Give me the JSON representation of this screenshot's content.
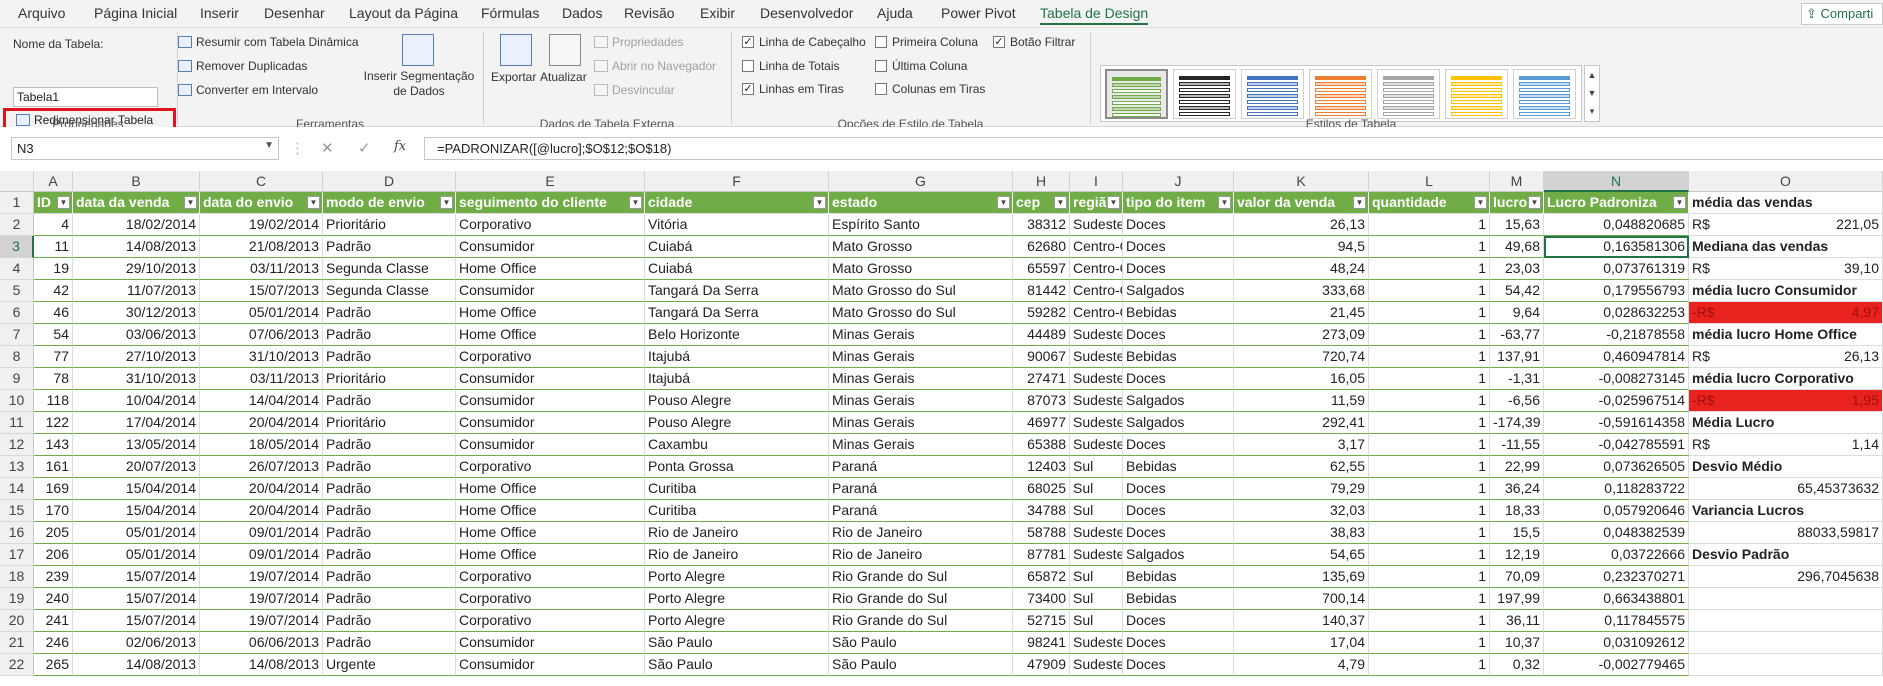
{
  "menu": {
    "tabs": [
      "Arquivo",
      "Página Inicial",
      "Inserir",
      "Desenhar",
      "Layout da Página",
      "Fórmulas",
      "Dados",
      "Revisão",
      "Exibir",
      "Desenvolvedor",
      "Ajuda",
      "Power Pivot",
      "Tabela de Design"
    ],
    "active": "Tabela de Design",
    "share": "Comparti"
  },
  "ribbon": {
    "propriedades": {
      "name_label": "Nome da Tabela:",
      "name_value": "Tabela1",
      "resize": "Redimensionar Tabela",
      "group": "Propriedades"
    },
    "ferramentas": {
      "pivot": "Resumir com Tabela Dinâmica",
      "dedupe": "Remover Duplicadas",
      "convert": "Converter em Intervalo",
      "slicer": "Inserir Segmentação de Dados",
      "group": "Ferramentas"
    },
    "externa": {
      "export": "Exportar",
      "refresh": "Atualizar",
      "props": "Propriedades",
      "browser": "Abrir no Navegador",
      "unlink": "Desvincular",
      "group": "Dados de Tabela Externa"
    },
    "estilo": {
      "header_row": "Linha de Cabeçalho",
      "total_row": "Linha de Totais",
      "banded_rows": "Linhas em Tiras",
      "first_col": "Primeira Coluna",
      "last_col": "Última Coluna",
      "banded_cols": "Colunas em Tiras",
      "filter_btn": "Botão Filtrar",
      "group": "Opções de Estilo de Tabela"
    },
    "estilos": {
      "group": "Estilos de Tabela",
      "colors": [
        "#70ad47",
        "#262626",
        "#4472c4",
        "#ed7d31",
        "#a5a5a5",
        "#ffc000",
        "#5b9bd5"
      ]
    }
  },
  "formula_bar": {
    "cell": "N3",
    "formula": "=PADRONIZAR([@lucro];$O$12;$O$18)",
    "fx": "fx"
  },
  "columns": [
    "A",
    "B",
    "C",
    "D",
    "E",
    "F",
    "G",
    "H",
    "I",
    "J",
    "K",
    "L",
    "M",
    "N",
    "O"
  ],
  "table": {
    "headers": [
      "ID",
      "data da venda",
      "data do envio",
      "modo de envio",
      "seguimento do cliente",
      "cidade",
      "estado",
      "cep",
      "região",
      "tipo do item",
      "valor da venda",
      "quantidade",
      "lucro",
      "Lucro Padroniza"
    ],
    "rows": [
      [
        "4",
        "18/02/2014",
        "19/02/2014",
        "Prioritário",
        "Corporativo",
        "Vitória",
        "Espírito Santo",
        "38312",
        "Sudeste",
        "Doces",
        "26,13",
        "1",
        "15,63",
        "0,048820685"
      ],
      [
        "11",
        "14/08/2013",
        "21/08/2013",
        "Padrão",
        "Consumidor",
        "Cuiabá",
        "Mato Grosso",
        "62680",
        "Centro-Oeste",
        "Doces",
        "94,5",
        "1",
        "49,68",
        "0,163581306"
      ],
      [
        "19",
        "29/10/2013",
        "03/11/2013",
        "Segunda Classe",
        "Home Office",
        "Cuiabá",
        "Mato Grosso",
        "65597",
        "Centro-Oeste",
        "Doces",
        "48,24",
        "1",
        "23,03",
        "0,073761319"
      ],
      [
        "42",
        "11/07/2013",
        "15/07/2013",
        "Segunda Classe",
        "Consumidor",
        "Tangará Da Serra",
        "Mato Grosso do Sul",
        "81442",
        "Centro-Oeste",
        "Salgados",
        "333,68",
        "1",
        "54,42",
        "0,179556793"
      ],
      [
        "46",
        "30/12/2013",
        "05/01/2014",
        "Padrão",
        "Home Office",
        "Tangará Da Serra",
        "Mato Grosso do Sul",
        "59282",
        "Centro-Oeste",
        "Bebidas",
        "21,45",
        "1",
        "9,64",
        "0,028632253"
      ],
      [
        "54",
        "03/06/2013",
        "07/06/2013",
        "Padrão",
        "Home Office",
        "Belo Horizonte",
        "Minas Gerais",
        "44489",
        "Sudeste",
        "Doces",
        "273,09",
        "1",
        "-63,77",
        "-0,21878558"
      ],
      [
        "77",
        "27/10/2013",
        "31/10/2013",
        "Padrão",
        "Corporativo",
        "Itajubá",
        "Minas Gerais",
        "90067",
        "Sudeste",
        "Bebidas",
        "720,74",
        "1",
        "137,91",
        "0,460947814"
      ],
      [
        "78",
        "31/10/2013",
        "03/11/2013",
        "Prioritário",
        "Consumidor",
        "Itajubá",
        "Minas Gerais",
        "27471",
        "Sudeste",
        "Doces",
        "16,05",
        "1",
        "-1,31",
        "-0,008273145"
      ],
      [
        "118",
        "10/04/2014",
        "14/04/2014",
        "Padrão",
        "Consumidor",
        "Pouso Alegre",
        "Minas Gerais",
        "87073",
        "Sudeste",
        "Salgados",
        "11,59",
        "1",
        "-6,56",
        "-0,025967514"
      ],
      [
        "122",
        "17/04/2014",
        "20/04/2014",
        "Prioritário",
        "Consumidor",
        "Pouso Alegre",
        "Minas Gerais",
        "46977",
        "Sudeste",
        "Salgados",
        "292,41",
        "1",
        "-174,39",
        "-0,591614358"
      ],
      [
        "143",
        "13/05/2014",
        "18/05/2014",
        "Padrão",
        "Consumidor",
        "Caxambu",
        "Minas Gerais",
        "65388",
        "Sudeste",
        "Doces",
        "3,17",
        "1",
        "-11,55",
        "-0,042785591"
      ],
      [
        "161",
        "20/07/2013",
        "26/07/2013",
        "Padrão",
        "Corporativo",
        "Ponta Grossa",
        "Paraná",
        "12403",
        "Sul",
        "Bebidas",
        "62,55",
        "1",
        "22,99",
        "0,073626505"
      ],
      [
        "169",
        "15/04/2014",
        "20/04/2014",
        "Padrão",
        "Home Office",
        "Curitiba",
        "Paraná",
        "68025",
        "Sul",
        "Doces",
        "79,29",
        "1",
        "36,24",
        "0,118283722"
      ],
      [
        "170",
        "15/04/2014",
        "20/04/2014",
        "Padrão",
        "Home Office",
        "Curitiba",
        "Paraná",
        "34788",
        "Sul",
        "Doces",
        "32,03",
        "1",
        "18,33",
        "0,057920646"
      ],
      [
        "205",
        "05/01/2014",
        "09/01/2014",
        "Padrão",
        "Home Office",
        "Rio de Janeiro",
        "Rio de Janeiro",
        "58788",
        "Sudeste",
        "Doces",
        "38,83",
        "1",
        "15,5",
        "0,048382539"
      ],
      [
        "206",
        "05/01/2014",
        "09/01/2014",
        "Padrão",
        "Home Office",
        "Rio de Janeiro",
        "Rio de Janeiro",
        "87781",
        "Sudeste",
        "Salgados",
        "54,65",
        "1",
        "12,19",
        "0,03722666"
      ],
      [
        "239",
        "15/07/2014",
        "19/07/2014",
        "Padrão",
        "Corporativo",
        "Porto Alegre",
        "Rio Grande do Sul",
        "65872",
        "Sul",
        "Bebidas",
        "135,69",
        "1",
        "70,09",
        "0,232370271"
      ],
      [
        "240",
        "15/07/2014",
        "19/07/2014",
        "Padrão",
        "Corporativo",
        "Porto Alegre",
        "Rio Grande do Sul",
        "73400",
        "Sul",
        "Bebidas",
        "700,14",
        "1",
        "197,99",
        "0,663438801"
      ],
      [
        "241",
        "15/07/2014",
        "19/07/2014",
        "Padrão",
        "Corporativo",
        "Porto Alegre",
        "Rio Grande do Sul",
        "52715",
        "Sul",
        "Doces",
        "140,37",
        "1",
        "36,11",
        "0,117845575"
      ],
      [
        "246",
        "02/06/2013",
        "06/06/2013",
        "Padrão",
        "Consumidor",
        "São Paulo",
        "São Paulo",
        "98241",
        "Sudeste",
        "Doces",
        "17,04",
        "1",
        "10,37",
        "0,031092612"
      ],
      [
        "265",
        "14/08/2013",
        "14/08/2013",
        "Urgente",
        "Consumidor",
        "São Paulo",
        "São Paulo",
        "47909",
        "Sudeste",
        "Doces",
        "4,79",
        "1",
        "0,32",
        "-0,002779465"
      ]
    ]
  },
  "column_o": [
    {
      "text": "média das vendas",
      "style": "bold"
    },
    {
      "cur": "R$",
      "val": "221,05"
    },
    {
      "text": "Mediana das vendas",
      "style": "bold"
    },
    {
      "cur": "R$",
      "val": "39,10"
    },
    {
      "text": "média lucro Consumidor",
      "style": "bold"
    },
    {
      "cur": "-R$",
      "val": "4,97",
      "style": "red"
    },
    {
      "text": "média lucro Home Office",
      "style": "bold"
    },
    {
      "cur": "R$",
      "val": "26,13"
    },
    {
      "text": "média lucro Corporativo",
      "style": "bold"
    },
    {
      "cur": "-R$",
      "val": "1,95",
      "style": "red"
    },
    {
      "text": "Média Lucro",
      "style": "bold"
    },
    {
      "cur": "R$",
      "val": "1,14"
    },
    {
      "text": "Desvio Médio",
      "style": "bold"
    },
    {
      "val": "65,45373632"
    },
    {
      "text": "Variancia Lucros",
      "style": "bold"
    },
    {
      "val": "88033,59817"
    },
    {
      "text": "Desvio Padrão",
      "style": "bold"
    },
    {
      "val": "296,7045638"
    },
    {},
    {},
    {}
  ]
}
